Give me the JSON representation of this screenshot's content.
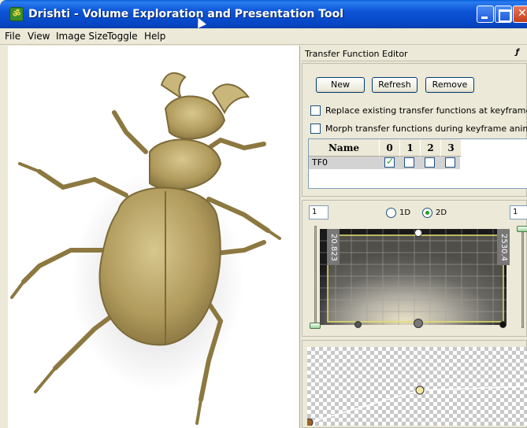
{
  "window": {
    "title": "Drishti - Volume Exploration and Presentation Tool",
    "icon": "om-icon"
  },
  "menu": [
    "File",
    "View",
    "Image Size",
    "Toggle",
    "Help"
  ],
  "dock": {
    "title": "Transfer Function Editor",
    "float_icon": "ƒ"
  },
  "tf_editor": {
    "buttons": {
      "new": "New",
      "refresh": "Refresh",
      "remove": "Remove"
    },
    "options": {
      "replace_label": "Replace existing transfer functions at keyframes",
      "replace_checked": false,
      "morph_label": "Morph transfer functions during keyframe animation",
      "morph_checked": false
    },
    "table": {
      "headers": [
        "Name",
        "0",
        "1",
        "2",
        "3"
      ],
      "rows": [
        {
          "name": "TF0",
          "sets": [
            true,
            false,
            false,
            false
          ]
        }
      ]
    }
  },
  "tf2d": {
    "left_spin": "1",
    "right_spin": "1",
    "mode_1d": "1D",
    "mode_2d": "2D",
    "selected_mode": "2D",
    "left_value": "20.823",
    "right_value": "2530.4"
  },
  "colors": {
    "specimen": "#b5a066",
    "title_bar": "#0a54d6",
    "check_green": "#21a121"
  }
}
